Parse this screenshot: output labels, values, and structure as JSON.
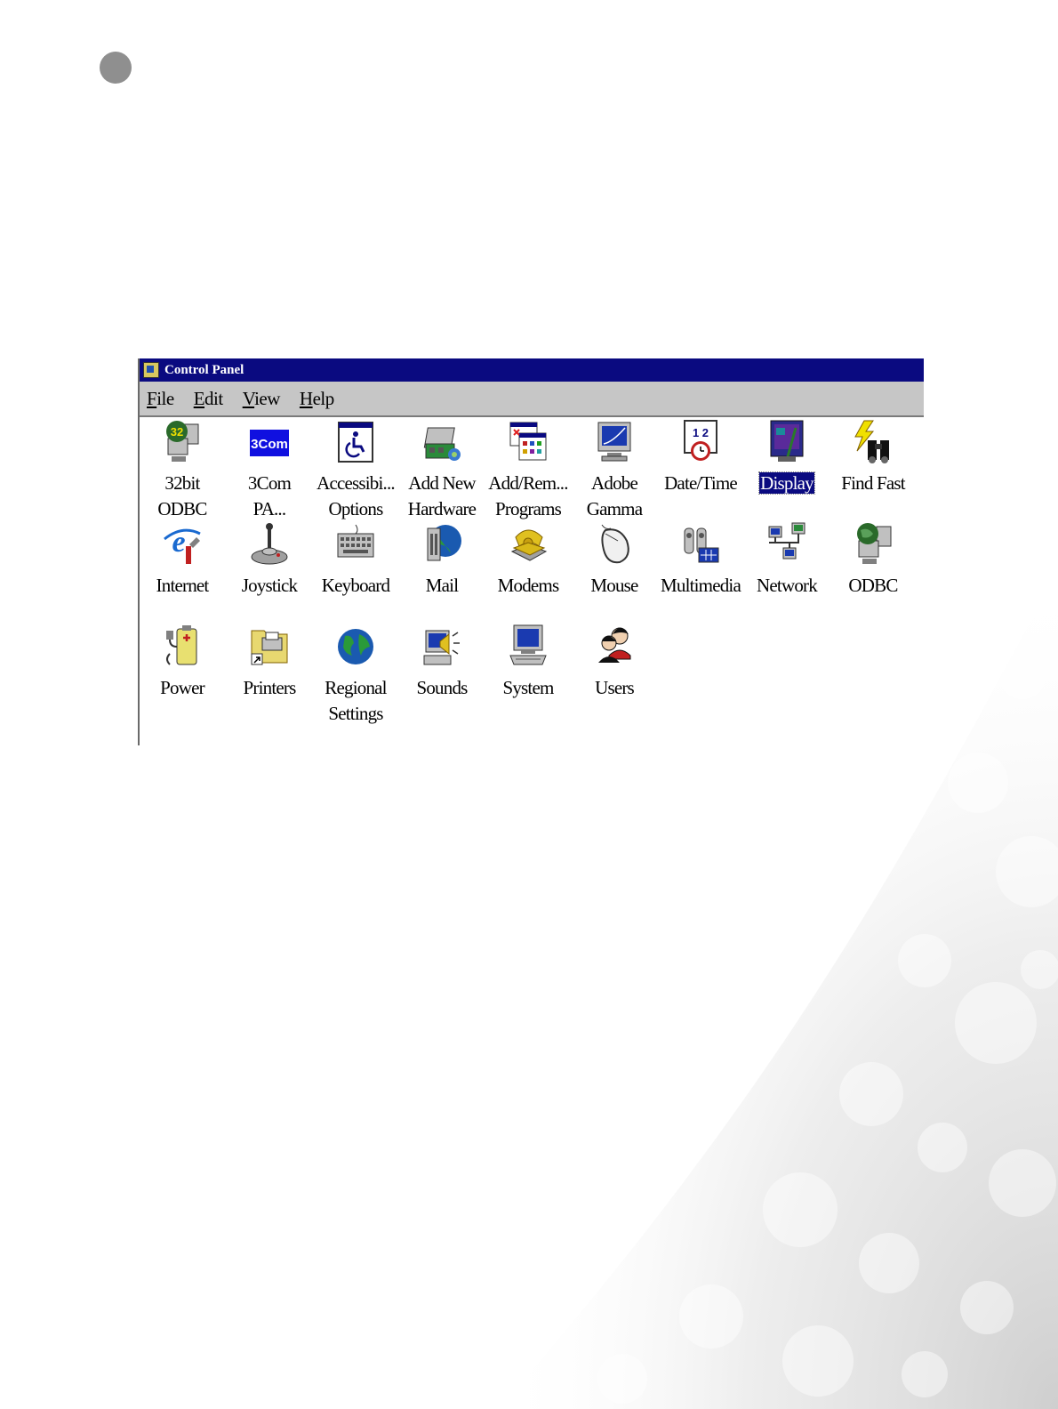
{
  "window": {
    "title": "Control Panel",
    "menu": [
      {
        "label": "File",
        "accel": "F",
        "rest": "ile"
      },
      {
        "label": "Edit",
        "accel": "E",
        "rest": "dit"
      },
      {
        "label": "View",
        "accel": "V",
        "rest": "iew"
      },
      {
        "label": "Help",
        "accel": "H",
        "rest": "elp"
      }
    ]
  },
  "icons": [
    {
      "line1": "32bit",
      "line2": "ODBC",
      "icon": "odbc-32bit-icon"
    },
    {
      "line1": "3Com",
      "line2": "PA...",
      "icon": "3com-icon"
    },
    {
      "line1": "Accessibi...",
      "line2": "Options",
      "icon": "accessibility-icon"
    },
    {
      "line1": "Add New",
      "line2": "Hardware",
      "icon": "add-hardware-icon"
    },
    {
      "line1": "Add/Rem...",
      "line2": "Programs",
      "icon": "add-remove-programs-icon"
    },
    {
      "line1": "Adobe",
      "line2": "Gamma",
      "icon": "adobe-gamma-icon"
    },
    {
      "line1": "Date/Time",
      "line2": "",
      "icon": "date-time-icon"
    },
    {
      "line1": "Display",
      "line2": "",
      "icon": "display-icon",
      "selected": true
    },
    {
      "line1": "Find Fast",
      "line2": "",
      "icon": "find-fast-icon"
    },
    {
      "line1": "Internet",
      "line2": "",
      "icon": "internet-icon"
    },
    {
      "line1": "Joystick",
      "line2": "",
      "icon": "joystick-icon"
    },
    {
      "line1": "Keyboard",
      "line2": "",
      "icon": "keyboard-icon"
    },
    {
      "line1": "Mail",
      "line2": "",
      "icon": "mail-icon"
    },
    {
      "line1": "Modems",
      "line2": "",
      "icon": "modems-icon"
    },
    {
      "line1": "Mouse",
      "line2": "",
      "icon": "mouse-icon"
    },
    {
      "line1": "Multimedia",
      "line2": "",
      "icon": "multimedia-icon"
    },
    {
      "line1": "Network",
      "line2": "",
      "icon": "network-icon"
    },
    {
      "line1": "ODBC",
      "line2": "",
      "icon": "odbc-icon"
    },
    {
      "line1": "Power",
      "line2": "",
      "icon": "power-icon"
    },
    {
      "line1": "Printers",
      "line2": "",
      "icon": "printers-icon"
    },
    {
      "line1": "Regional",
      "line2": "Settings",
      "icon": "regional-settings-icon"
    },
    {
      "line1": "Sounds",
      "line2": "",
      "icon": "sounds-icon"
    },
    {
      "line1": "System",
      "line2": "",
      "icon": "system-icon"
    },
    {
      "line1": "Users",
      "line2": "",
      "icon": "users-icon"
    }
  ],
  "colors": {
    "titlebar": "#0a0a80",
    "menubar": "#c6c6c6",
    "selection": "#0a0a80"
  }
}
